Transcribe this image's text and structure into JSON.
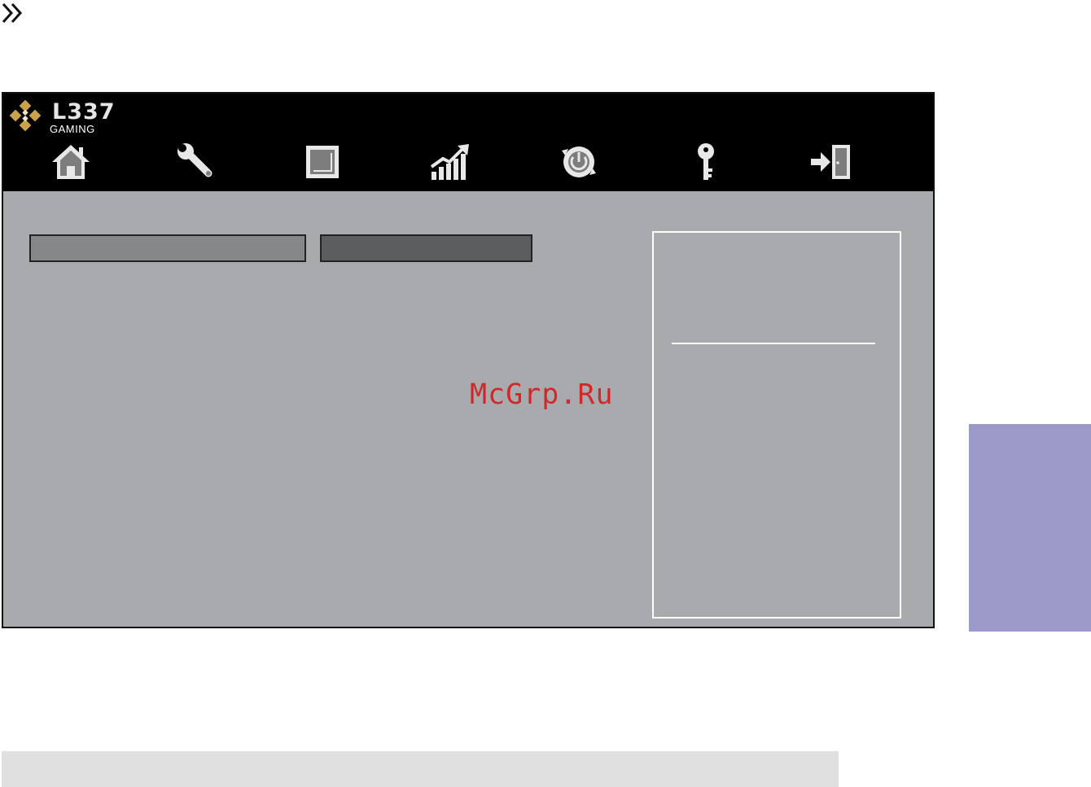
{
  "page_marker": {
    "icon": "double-chevron-right-icon"
  },
  "bios": {
    "logo": {
      "brand": "L337",
      "subtitle": "GAMING"
    },
    "nav": [
      {
        "name": "home",
        "icon": "home-icon"
      },
      {
        "name": "tools",
        "icon": "wrench-icon"
      },
      {
        "name": "chipset",
        "icon": "chip-icon"
      },
      {
        "name": "overclock",
        "icon": "chart-up-icon"
      },
      {
        "name": "boot",
        "icon": "power-icon"
      },
      {
        "name": "security",
        "icon": "key-icon"
      },
      {
        "name": "exit",
        "icon": "exit-icon"
      }
    ],
    "colors": {
      "header": "#000000",
      "body": "#a9aaad",
      "tab_active": "#5c5d5f",
      "tab_inactive": "#868789"
    }
  },
  "watermark": {
    "text": "McGrp.Ru",
    "color": "#cf2a2a"
  },
  "side_tab": {
    "color": "#9b99c7"
  },
  "footer": {
    "color": "#e0e0e0"
  }
}
